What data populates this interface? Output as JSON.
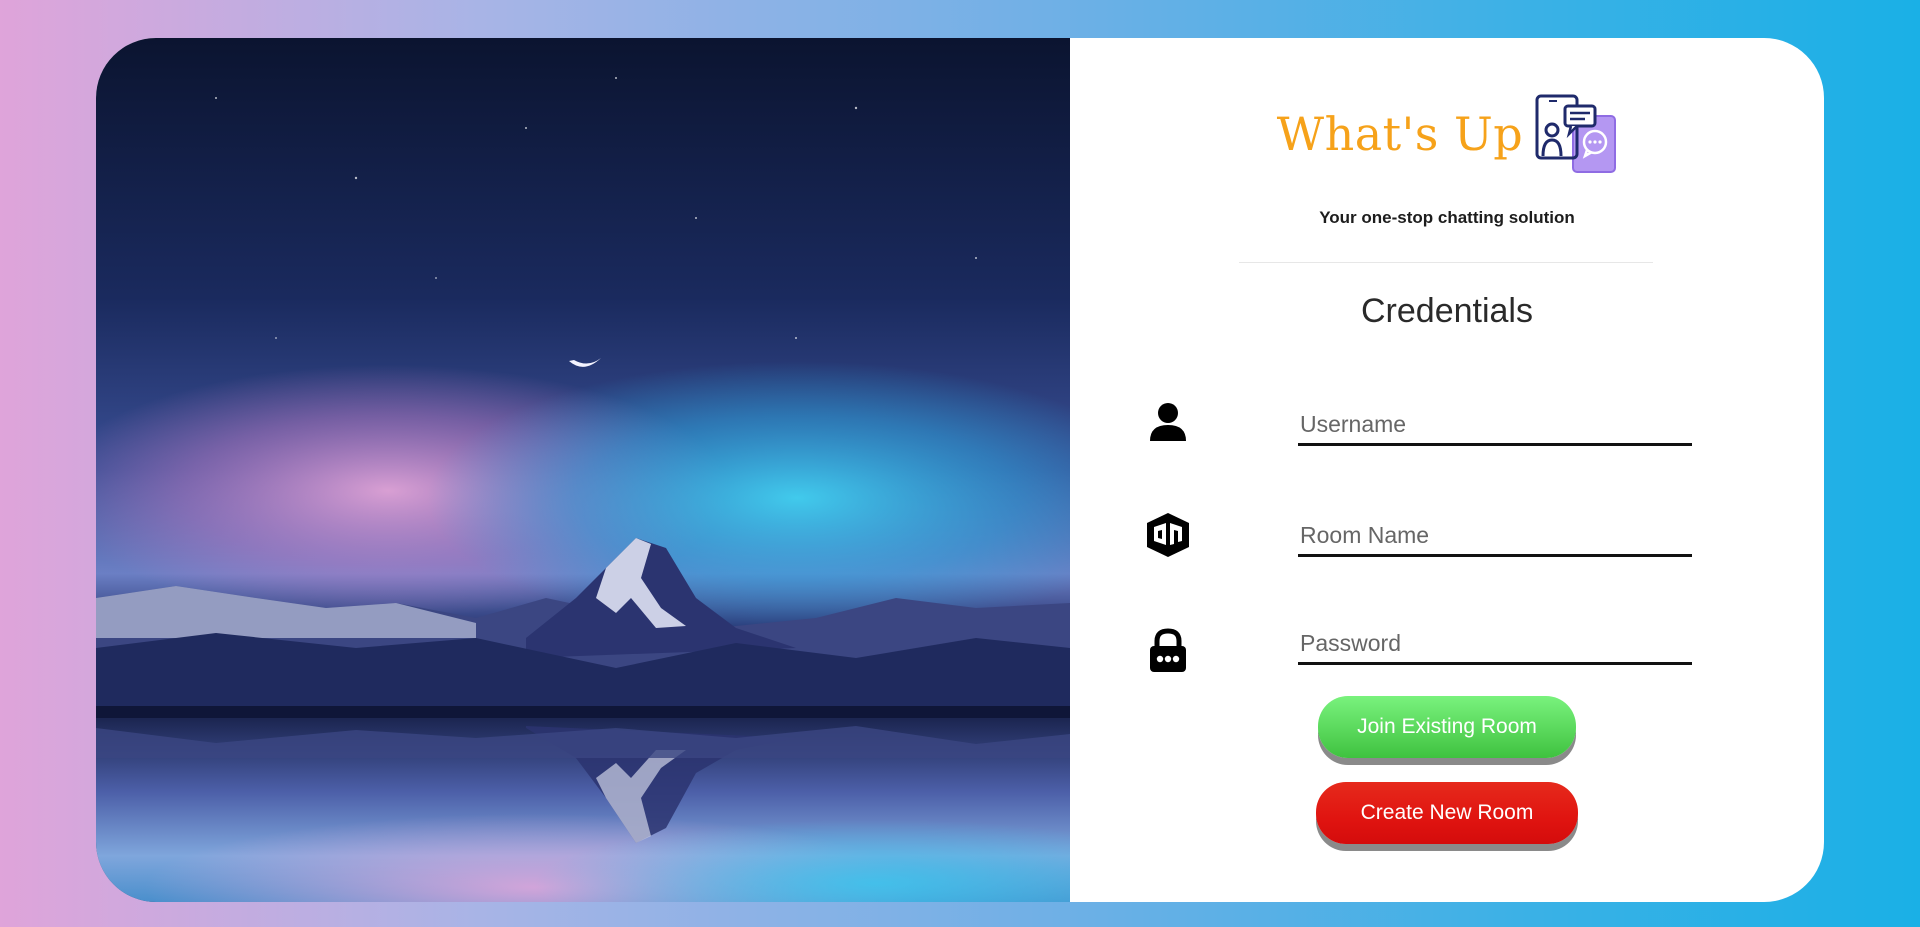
{
  "brand": {
    "title": "What's Up",
    "logo_icon": "chat-devices-icon",
    "title_color": "#f6a21a"
  },
  "tagline": "Your one-stop chatting solution",
  "form": {
    "heading": "Credentials",
    "fields": [
      {
        "icon": "user-icon",
        "placeholder": "Username",
        "value": ""
      },
      {
        "icon": "room-cube-icon",
        "placeholder": "Room Name",
        "value": ""
      },
      {
        "icon": "lock-icon",
        "placeholder": "Password",
        "value": ""
      }
    ]
  },
  "buttons": {
    "join_label": "Join Existing Room",
    "create_label": "Create New Room",
    "join_color": "#5ad85c",
    "create_color": "#e01410"
  },
  "hero": {
    "icon": "mountain-lake-image"
  }
}
